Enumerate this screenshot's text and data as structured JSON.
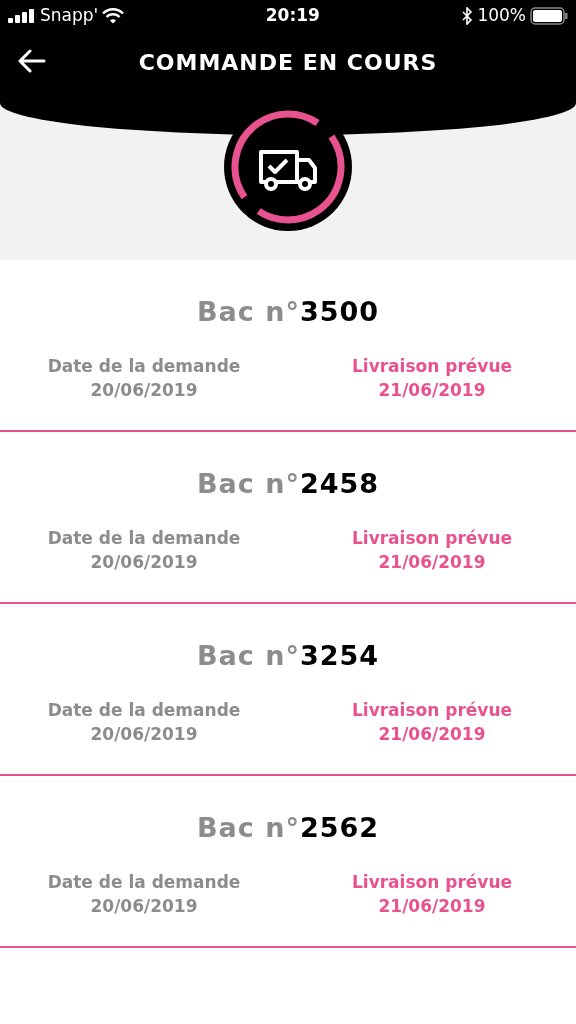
{
  "status_bar": {
    "carrier": "Snapp'",
    "time": "20:19",
    "battery": "100%"
  },
  "header": {
    "title": "COMMANDE EN COURS"
  },
  "orders": [
    {
      "bin": "Bac n°**3500**",
      "request_label": "Date de la demande",
      "request_date": "20/06/2019",
      "delivery_label": "Livraison prévue",
      "delivery_date": "21/06/2019"
    },
    {
      "bin": "Bac n°**2458**",
      "request_label": "Date de la demande",
      "request_date": "20/06/2019",
      "delivery_label": "Livraison prévue",
      "delivery_date": "21/06/2019"
    },
    {
      "bin": "Bac n°**3254**",
      "request_label": "Date de la demande",
      "request_date": "20/06/2019",
      "delivery_label": "Livraison prévue",
      "delivery_date": "21/06/2019"
    },
    {
      "bin": "Bac n°**2562**",
      "request_label": "Date de la demande",
      "request_date": "20/06/2019",
      "delivery_label": "Livraison prévue",
      "delivery_date": "21/06/2019"
    }
  ]
}
